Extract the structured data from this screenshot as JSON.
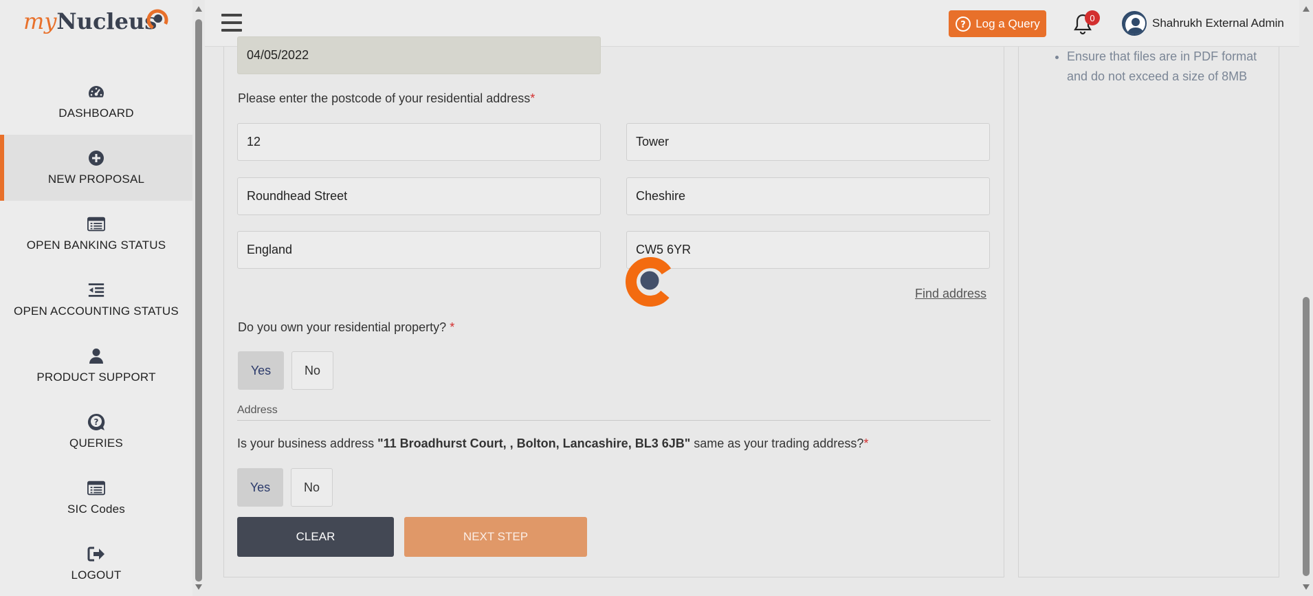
{
  "brand": {
    "logo_my": "my",
    "logo_nucleus": "Nucleus"
  },
  "sidebar": {
    "items": [
      {
        "label": "DASHBOARD",
        "icon": "dashboard-icon"
      },
      {
        "label": "NEW PROPOSAL",
        "icon": "plus-circle-icon",
        "active": true
      },
      {
        "label": "OPEN BANKING STATUS",
        "icon": "list-card-icon"
      },
      {
        "label": "OPEN ACCOUNTING STATUS",
        "icon": "indent-list-icon"
      },
      {
        "label": "PRODUCT SUPPORT",
        "icon": "user-icon"
      },
      {
        "label": "QUERIES",
        "icon": "question-bubble-icon"
      },
      {
        "label": "SIC Codes",
        "icon": "list-card-icon"
      },
      {
        "label": "LOGOUT",
        "icon": "sign-out-icon"
      }
    ]
  },
  "topbar": {
    "log_query_label": "Log a Query",
    "notification_count": "0",
    "user_name": "Shahrukh External Admin"
  },
  "form": {
    "date_value": "04/05/2022",
    "postcode_question": "Please enter the postcode of your residential address",
    "address_fields": {
      "house_number": "12",
      "building": "Tower",
      "street": "Roundhead Street",
      "county": "Cheshire",
      "country": "England",
      "postcode": "CW5 6YR"
    },
    "find_address_label": "Find address",
    "own_property_question": "Do you own your residential property?",
    "own_property": {
      "yes": "Yes",
      "no": "No",
      "selected": "Yes"
    },
    "section_label": "Address",
    "business_address_prefix": "Is your business address ",
    "business_address_value": "\"11 Broadhurst Court, , Bolton, Lancashire, BL3 6JB\"",
    "business_address_suffix": " same as your trading address?",
    "same_address": {
      "yes": "Yes",
      "no": "No",
      "selected": "Yes"
    },
    "required_mark": "*",
    "clear_label": "CLEAR",
    "next_label": "NEXT STEP"
  },
  "side_panel": {
    "notes": [
      "Ensure that files are in PDF format and do not exceed a size of 8MB"
    ]
  },
  "colors": {
    "accent": "#e8702a",
    "dark_button": "#434854",
    "next_button": "#e09868",
    "required": "#d32f2f"
  }
}
